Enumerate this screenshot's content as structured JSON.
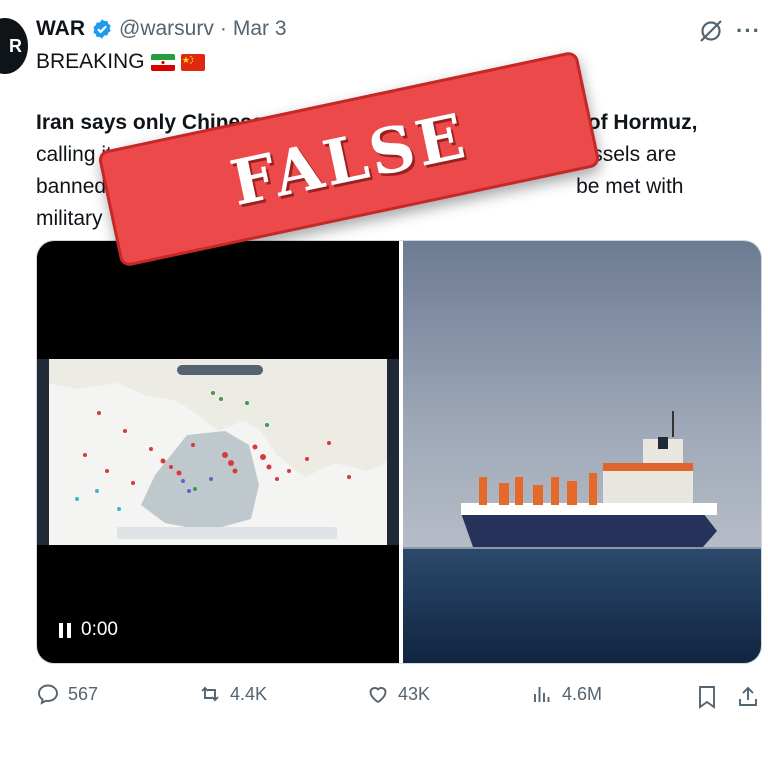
{
  "avatar": {
    "text": "R"
  },
  "header": {
    "display_name": "WAR",
    "handle": "@warsurv",
    "separator": "·",
    "date": "Mar 3",
    "more_label": "···"
  },
  "tweet": {
    "breaking": "BREAKING",
    "flags": [
      "iran-flag",
      "china-flag"
    ],
    "line1_bold_a": "Iran says only Chinese shi",
    "line1_bold_b": "of Hormuz,",
    "line2_a": "calling it a “",
    "line2_b": "r vessels are",
    "line3_a": "banned",
    "line3_b": "be met with",
    "line4_a": "military"
  },
  "stamp": {
    "text": "FALSE"
  },
  "media": {
    "video_time": "0:00",
    "icons": [
      "pause-icon"
    ]
  },
  "actions": {
    "replies": "567",
    "reposts": "4.4K",
    "likes": "43K",
    "views": "4.6M"
  },
  "colors": {
    "text": "#0f1419",
    "secondary": "#536471",
    "verified": "#1d9bf0",
    "stamp": "#ec4a4a"
  }
}
